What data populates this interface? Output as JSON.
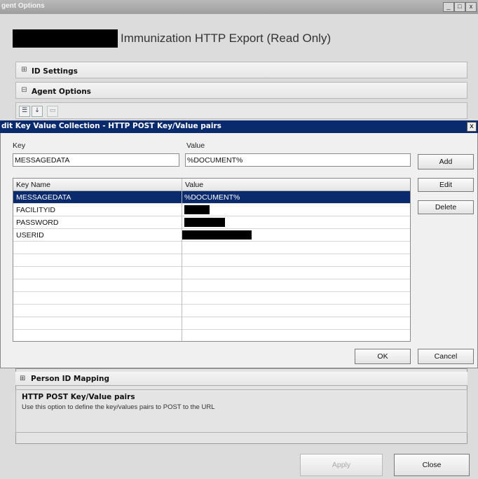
{
  "outer_window": {
    "title": "gent Options",
    "min_glyph": "_",
    "max_glyph": "□",
    "close_glyph": "x",
    "heading": "Immunization HTTP Export (Read Only)"
  },
  "sections": {
    "id_settings": {
      "symbol": "⊞",
      "label": "ID Settings"
    },
    "agent_options": {
      "symbol": "⊟",
      "label": "Agent Options"
    }
  },
  "toolbar": {
    "categorized_icon": "categorized-icon",
    "sort_icon": "sort-alpha-icon",
    "property_pages_icon": "property-pages-icon"
  },
  "dialog": {
    "title": "dit Key Value Collection - HTTP POST Key/Value pairs",
    "close_glyph": "x",
    "key_label": "Key",
    "value_label": "Value",
    "key_value": "MESSAGEDATA",
    "value_value": "%DOCUMENT%",
    "add_label": "Add",
    "edit_label": "Edit",
    "delete_label": "Delete",
    "ok_label": "OK",
    "cancel_label": "Cancel",
    "grid": {
      "columns": [
        "Key Name",
        "Value"
      ],
      "rows": [
        {
          "key": "MESSAGEDATA",
          "value": "%DOCUMENT%",
          "selected": true
        },
        {
          "key": "FACILITYID",
          "value": "",
          "redacted": true
        },
        {
          "key": "PASSWORD",
          "value": "",
          "redacted": true
        },
        {
          "key": "USERID",
          "value": "",
          "redacted": true
        }
      ]
    }
  },
  "lower": {
    "person_symbol": "⊞",
    "person_label": "Person ID Mapping",
    "help_title": "HTTP POST Key/Value pairs",
    "help_text": "Use this option to define the key/values pairs to POST to the URL"
  },
  "footer": {
    "apply_label": "Apply",
    "close_label": "Close"
  },
  "colors": {
    "dialog_titlebar": "#0a2a6e",
    "selection": "#0a2a6e"
  }
}
